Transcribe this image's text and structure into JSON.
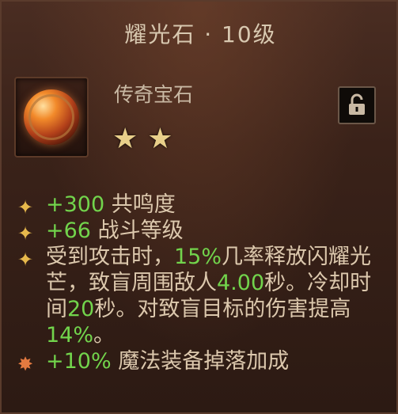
{
  "item": {
    "title": "耀光石 · 10级",
    "subtitle": "传奇宝石",
    "star_count": 2,
    "lock_icon": "unlocked-padlock-icon",
    "gem_icon": "legendary-gem-icon"
  },
  "stats": [
    {
      "value": "+300",
      "label": " 共鸣度"
    },
    {
      "value": "+66",
      "label": " 战斗等级"
    }
  ],
  "effect": {
    "p1": "受到攻击时，",
    "g1": "15%",
    "p2": "几率释放闪耀光芒，致盲周围敌人",
    "g2": "4.00",
    "p3": "秒。冷却时间",
    "g3": "20",
    "p4": "秒。对致盲目标的伤害提高",
    "g4": "14%",
    "p5": "。"
  },
  "bonus": {
    "value": "+10%",
    "label": " 魔法装备掉落加成"
  },
  "colors": {
    "accent_green": "#72d44c",
    "text": "#dcc8ad",
    "bullet_gold": "#e7b94c"
  }
}
